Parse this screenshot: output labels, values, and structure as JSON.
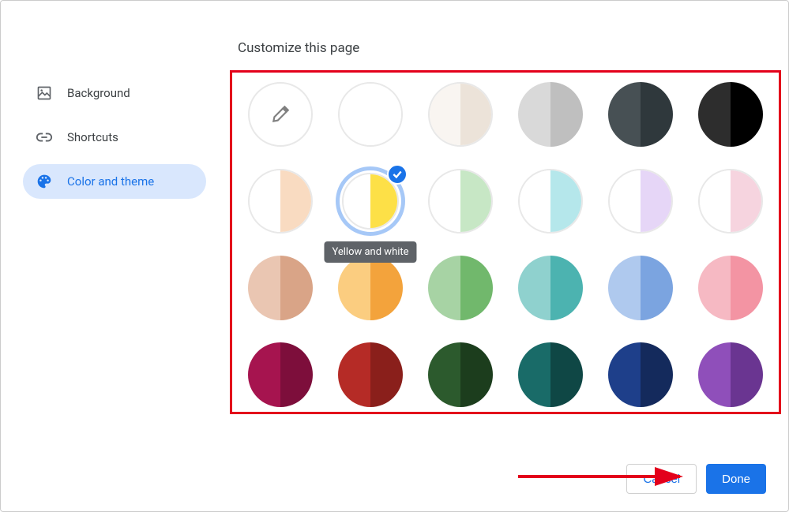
{
  "title": "Customize this page",
  "sidebar": {
    "items": [
      {
        "label": "Background"
      },
      {
        "label": "Shortcuts"
      },
      {
        "label": "Color and theme"
      }
    ],
    "activeIndex": 2
  },
  "selected_swatch_tooltip": "Yellow and white",
  "swatches": [
    {
      "type": "picker"
    },
    {
      "left": "#ffffff",
      "right": "#ffffff",
      "borderLight": true
    },
    {
      "left": "#f9f5f1",
      "right": "#ece3d9",
      "borderLight": true
    },
    {
      "left": "#d9d9d9",
      "right": "#bfbfbf"
    },
    {
      "left": "#475054",
      "right": "#2f383c"
    },
    {
      "left": "#2d2d2d",
      "right": "#000000"
    },
    {
      "left": "#ffffff",
      "right": "#f9dbc1",
      "borderLight": true
    },
    {
      "left": "#ffffff",
      "right": "#fde047",
      "selected": true,
      "borderLight": true
    },
    {
      "left": "#ffffff",
      "right": "#c7e7c5",
      "borderLight": true
    },
    {
      "left": "#ffffff",
      "right": "#b5e7eb",
      "borderLight": true
    },
    {
      "left": "#ffffff",
      "right": "#e6d6f7",
      "borderLight": true
    },
    {
      "left": "#ffffff",
      "right": "#f6d4df",
      "borderLight": true
    },
    {
      "left": "#eac6b2",
      "right": "#d9a487"
    },
    {
      "left": "#fbcd80",
      "right": "#f3a33c"
    },
    {
      "left": "#a7d3a4",
      "right": "#71b86c"
    },
    {
      "left": "#8fd1ce",
      "right": "#4cb3b0"
    },
    {
      "left": "#afc9ee",
      "right": "#7ba4e0"
    },
    {
      "left": "#f6b9c3",
      "right": "#f394a3"
    },
    {
      "left": "#a6144f",
      "right": "#7d0e3b"
    },
    {
      "left": "#b52b26",
      "right": "#8a1f1b"
    },
    {
      "left": "#2c5a2d",
      "right": "#1c3d1d"
    },
    {
      "left": "#196b68",
      "right": "#0f4745"
    },
    {
      "left": "#1e3f8a",
      "right": "#142a5c"
    },
    {
      "left": "#8f4fba",
      "right": "#6a3591"
    }
  ],
  "footer": {
    "cancel": "Cancel",
    "done": "Done"
  },
  "annotation": {
    "arrowColor": "#e3001b"
  }
}
